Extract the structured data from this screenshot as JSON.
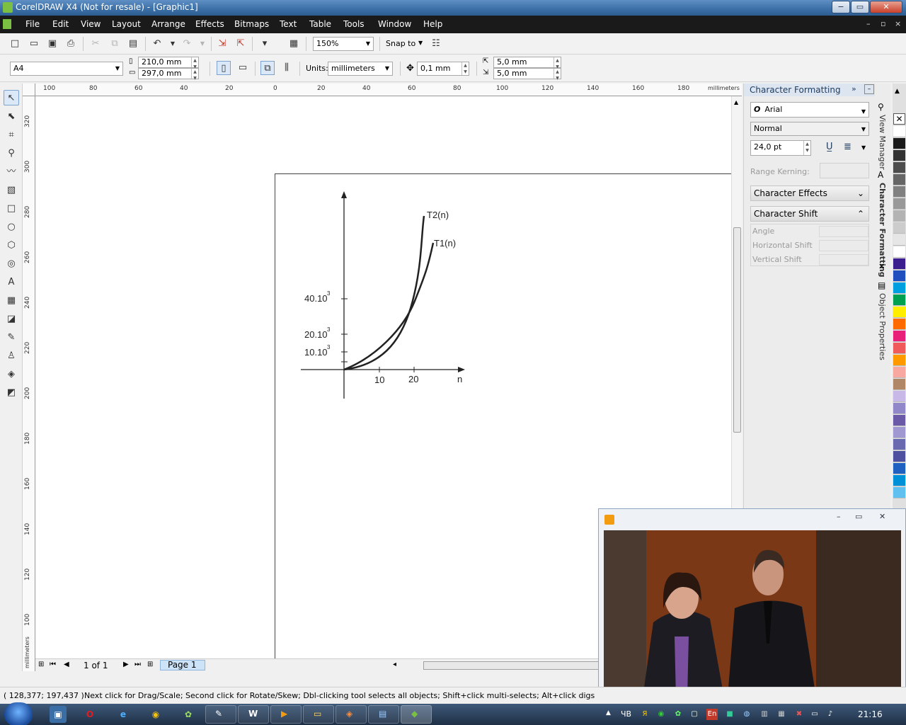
{
  "window": {
    "title": "CorelDRAW X4 (Not for resale) - [Graphic1]",
    "minimize": "−",
    "restore": "▭",
    "close": "✕"
  },
  "menu": [
    "File",
    "Edit",
    "View",
    "Layout",
    "Arrange",
    "Effects",
    "Bitmaps",
    "Text",
    "Table",
    "Tools",
    "Window",
    "Help"
  ],
  "standard_toolbar": {
    "zoom": "150%",
    "snap_to": "Snap to"
  },
  "property_bar": {
    "paper_size": "A4",
    "width": "210,0 mm",
    "height": "297,0 mm",
    "units_label": "Units:",
    "units": "millimeters",
    "nudge": "0,1 mm",
    "dup_x": "5,0 mm",
    "dup_y": "5,0 mm"
  },
  "rulers": {
    "horizontal_ticks": [
      "100",
      "80",
      "60",
      "40",
      "20",
      "0",
      "20",
      "40",
      "60",
      "80",
      "100",
      "120",
      "140",
      "160",
      "180"
    ],
    "horizontal_unit": "millimeters",
    "vertical_ticks": [
      "320",
      "300",
      "280",
      "260",
      "240",
      "220",
      "200",
      "180",
      "160",
      "140",
      "120",
      "100"
    ],
    "vertical_unit": "millimeters"
  },
  "graph": {
    "curve_t2": "T2(n)",
    "curve_t1": "T1(n)",
    "y_labels": [
      "40.10",
      "20.10",
      "10.10"
    ],
    "y_exponent": "3",
    "x_labels": [
      "10",
      "20"
    ],
    "x_axis": "n"
  },
  "page_nav": {
    "page_count": "1 of 1",
    "page_tab": "Page 1"
  },
  "docker": {
    "title": "Character Formatting",
    "font": "Arial",
    "style": "Normal",
    "size": "24,0 pt",
    "range_kerning": "Range Kerning:",
    "character_effects": "Character Effects",
    "character_shift": "Character Shift",
    "angle": "Angle",
    "horizontal_shift": "Horizontal Shift",
    "vertical_shift": "Vertical Shift",
    "tabs": [
      "View Manager",
      "Character Formatting",
      "Object Properties"
    ]
  },
  "palette_colors": [
    "#ffffff",
    "#1a1a1a",
    "#333333",
    "#4d4d4d",
    "#666666",
    "#808080",
    "#999999",
    "#b3b3b3",
    "#cccccc",
    "#e6e6e6",
    "#ffffff",
    "#3b1d8f",
    "#1f4fbf",
    "#00a0e0",
    "#00a050",
    "#ffee00",
    "#ff6a00",
    "#e8207a",
    "#f05a5a",
    "#ff9900",
    "#f8a8a0",
    "#b08868",
    "#c8b8e8",
    "#9088c8",
    "#6a5aa8",
    "#a098d0",
    "#6a6ab0",
    "#5050a0",
    "#2060c0",
    "#0090d8",
    "#60c0f0"
  ],
  "status": {
    "coords": "( 128,377; 197,437 )",
    "hint": "Next click for Drag/Scale; Second click for Rotate/Skew; Dbl-clicking tool selects all objects; Shift+click multi-selects; Alt+click digs"
  },
  "taskbar": {
    "lang": "ЧВ",
    "kb": "En",
    "time": "21:16"
  }
}
